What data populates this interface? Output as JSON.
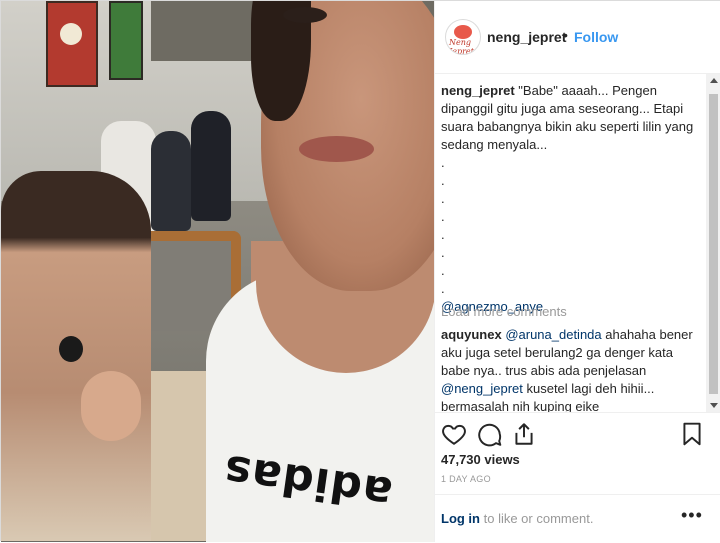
{
  "header": {
    "avatar_text": "Neng Jepret",
    "username": "neng_jepret",
    "separator": "•",
    "follow_label": "Follow"
  },
  "caption": {
    "username": "neng_jepret",
    "text": " \"Babe\" aaaah... Pengen dipanggil gitu juga ama seseorang... Etapi suara babangnya bikin aku seperti lilin yang sedang menyala...\n.\n.\n.\n.\n.\n.\n.\n.\n",
    "mention": "@agnezmo_anye"
  },
  "load_more": "Load more comments",
  "comment": {
    "username": "aquyunex",
    "mention1": "@aruna_detinda",
    "text1": " ahahaha bener aku juga setel berulang2 ga denger kata babe nya.. trus abis ada penjelasan ",
    "mention2": "@neng_jepret",
    "text2": " kusetel lagi deh hihii... bermasalah nih kuping eike"
  },
  "icons": {
    "like": "heart-icon",
    "comment": "comment-icon",
    "share": "share-icon",
    "save": "bookmark-icon",
    "more": "more-icon"
  },
  "views": "47,730 views",
  "time_ago": "1 DAY AGO",
  "footer": {
    "login_label": "Log in",
    "login_suffix": " to like or comment.",
    "more_label": "•••"
  },
  "media_text": "adidas",
  "colors": {
    "link": "#003569",
    "follow": "#3897f0",
    "muted": "#999999",
    "text": "#262626"
  }
}
